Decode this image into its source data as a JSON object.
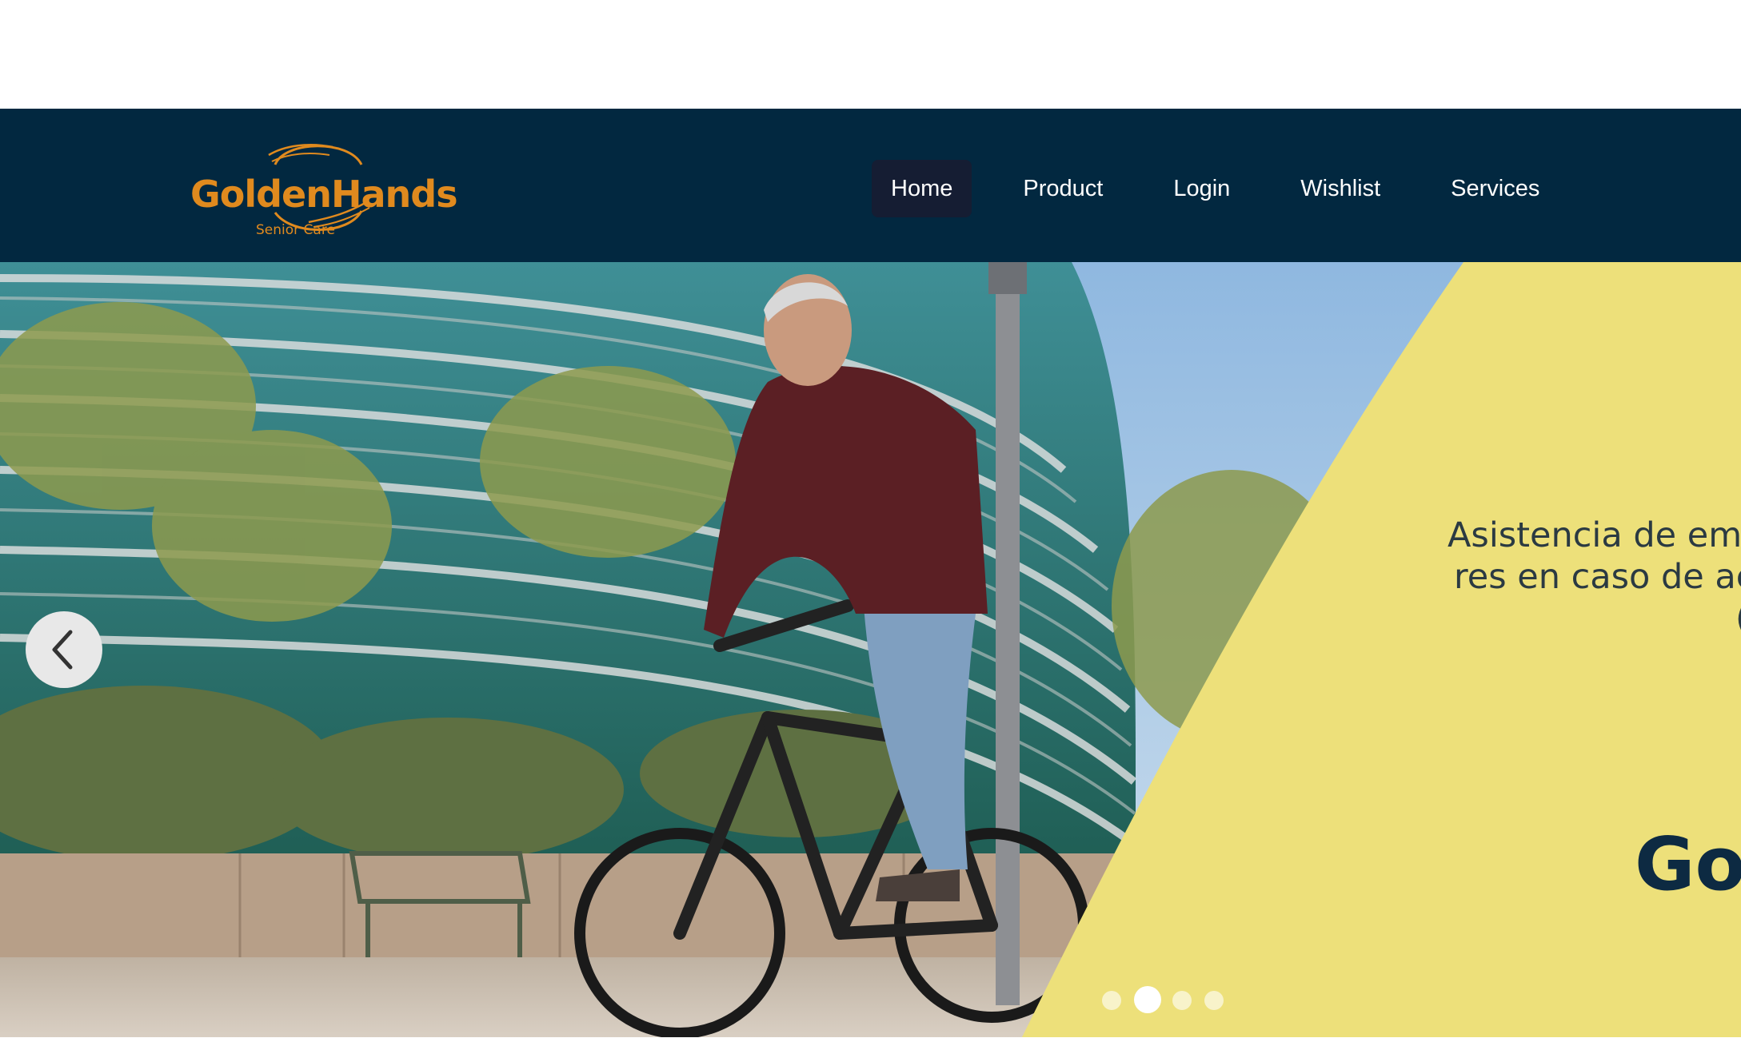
{
  "brand": {
    "name": "GoldenHands",
    "tagline": "Senior Care",
    "color": "#e08a1e"
  },
  "nav": {
    "background": "#022840",
    "items": [
      {
        "label": "Home",
        "active": true
      },
      {
        "label": "Product",
        "active": false
      },
      {
        "label": "Login",
        "active": false
      },
      {
        "label": "Wishlist",
        "active": false
      },
      {
        "label": "Services",
        "active": false
      }
    ]
  },
  "carousel": {
    "prev_icon": "chevron-left-icon",
    "active_index": 1,
    "slide_count": 4,
    "promo_lines": [
      "Asistencia de em",
      "res en caso de ac",
      "("
    ],
    "promo_brand": "Gol",
    "promo_color": "#ede07a"
  }
}
